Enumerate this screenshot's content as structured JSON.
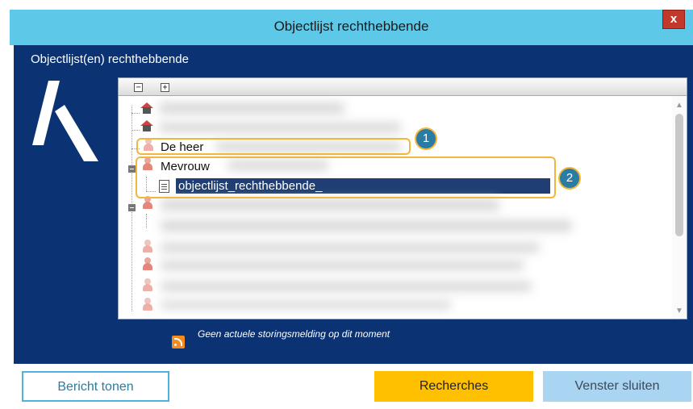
{
  "window": {
    "title": "Objectlijst rechthebbende",
    "close_label": "x"
  },
  "panel": {
    "heading": "Objectlijst(en) rechthebbende"
  },
  "tree": {
    "toolbar": {
      "collapse_all": "−",
      "expand_all": "+"
    },
    "nodes": {
      "de_heer": "De heer",
      "mevrouw": "Mevrouw",
      "selected_child": "objectlijst_rechthebbende_"
    }
  },
  "callouts": {
    "one": "1",
    "two": "2"
  },
  "status": {
    "message": "Geen actuele storingsmelding op dit moment"
  },
  "buttons": {
    "bericht_tonen": "Bericht tonen",
    "recherches": "Recherches",
    "venster_sluiten": "Venster sluiten"
  },
  "colors": {
    "titlebar": "#5ec8e8",
    "panel": "#0b3272",
    "accent_yellow": "#ffc000",
    "accent_blue": "#4fb2dc"
  }
}
